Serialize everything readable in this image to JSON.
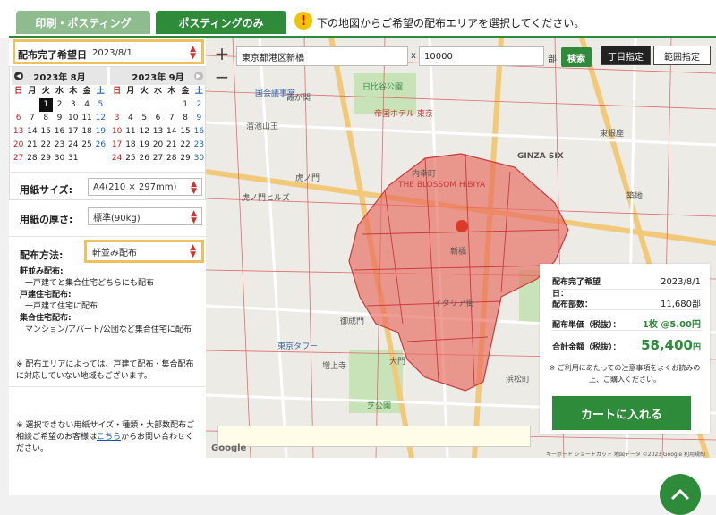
{
  "tabs": [
    {
      "label": "印刷・ポスティング"
    },
    {
      "label": "ポスティングのみ"
    }
  ],
  "notice": "下の地図からご希望の配布エリアを選択してください。",
  "sidebar": {
    "deadline_label": "配布完了希望日:",
    "deadline_value": "2023/8/1",
    "paper_size_label": "用紙サイズ:",
    "paper_size_value": "A4(210 × 297mm)",
    "paper_thickness_label": "用紙の厚さ:",
    "paper_thickness_value": "標準(90kg)",
    "method_label": "配布方法:",
    "method_value": "軒並み配布",
    "desc_nokinami_title": "軒並み配布:",
    "desc_nokinami_body": "一戸建てと集合住宅どちらにも配布",
    "desc_kodate_title": "戸建住宅配布:",
    "desc_kodate_body": "一戸建て住宅に配布",
    "desc_shugo_title": "集合住宅配布:",
    "desc_shugo_body": "マンション/アパート/公団など集合住宅に配布",
    "note1": "※ 配布エリアによっては、戸建て配布・集合配布に対応していない地域もございます。",
    "note2_a": "※ 選択できない用紙サイズ・種類・大部数配布ご相談ご希望のお客様は",
    "note2_link": "こちら",
    "note2_b": "からお問い合わせください。"
  },
  "calendar": {
    "months": [
      {
        "title": "2023年 8月",
        "weekdays": [
          "日",
          "月",
          "火",
          "水",
          "木",
          "金",
          "土"
        ],
        "weeks": [
          [
            "",
            "",
            "1",
            "2",
            "3",
            "4",
            "5"
          ],
          [
            "6",
            "7",
            "8",
            "9",
            "10",
            "11",
            "12"
          ],
          [
            "13",
            "14",
            "15",
            "16",
            "17",
            "18",
            "19"
          ],
          [
            "20",
            "21",
            "22",
            "23",
            "24",
            "25",
            "26"
          ],
          [
            "27",
            "28",
            "29",
            "30",
            "31",
            "",
            ""
          ]
        ],
        "selected": "1"
      },
      {
        "title": "2023年 9月",
        "weekdays": [
          "日",
          "月",
          "火",
          "水",
          "木",
          "金",
          "土"
        ],
        "weeks": [
          [
            "",
            "",
            "",
            "",
            "",
            "1",
            "2"
          ],
          [
            "3",
            "4",
            "5",
            "6",
            "7",
            "8",
            "9"
          ],
          [
            "10",
            "11",
            "12",
            "13",
            "14",
            "15",
            "16"
          ],
          [
            "17",
            "18",
            "19",
            "20",
            "21",
            "22",
            "23"
          ],
          [
            "24",
            "25",
            "26",
            "27",
            "28",
            "29",
            "30"
          ]
        ],
        "selected": ""
      }
    ]
  },
  "map": {
    "address_value": "東京都港区新橋",
    "separator": "x",
    "quantity_value": "10000",
    "quantity_unit": "部",
    "search_label": "検索",
    "mode_chome": "丁目指定",
    "mode_range": "範囲指定",
    "zoom_in": "+",
    "zoom_out": "−",
    "google": "Google",
    "attribution": "キーボード ショートカット  地図データ ©2023 Google  利用規約",
    "labels": {
      "hibiya_park": "日比谷公園",
      "kasumigaseki": "霞が関",
      "imperial_hotel": "帝国ホテル 東京",
      "ginza_six": "GINZA SIX",
      "blossom": "THE BLOSSOM HIBIYA",
      "uchisaiwaicho": "内幸町",
      "shimbashi": "新橋",
      "toranomon_hills": "虎ノ門ヒルズ",
      "onarimon": "御成門",
      "daimon": "大門",
      "tokyo_tower": "東京タワー",
      "shiba_park": "芝公園",
      "zojoji": "増上寺",
      "italy_gai": "イタリア街",
      "hamamatsucho": "浜松町",
      "tsukiji": "築地",
      "higashi_ginza": "東銀座",
      "toranomon": "虎ノ門",
      "kokkai": "国会議事堂",
      "sanno": "溜池山王"
    }
  },
  "summary": {
    "deadline_label": "配布完了希望日：",
    "deadline_value": "2023/8/1",
    "count_label": "配布部数：",
    "count_value": "11,680部",
    "unit_label": "配布単価（税抜）：",
    "unit_value": "1枚 @5.00円",
    "total_label": "合計金額（税抜）：",
    "total_value": "58,400",
    "total_unit": "円",
    "note": "※ ご利用にあたっての注意事項をよくお読みの上、ご購入ください。",
    "cart_button": "カートに入れる"
  },
  "colors": {
    "accent": "#2e8b3a",
    "highlight_border": "#f0c060",
    "area_fill": "#e8685e"
  }
}
